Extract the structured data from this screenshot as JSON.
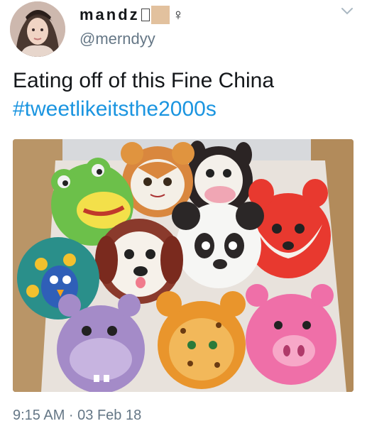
{
  "tweet": {
    "display_name_letters": "mandz",
    "display_name_symbol": "♀",
    "handle": "@merndyy",
    "text_line1": "Eating off of this Fine China",
    "hashtag": "#tweetlikeitsthe2000s",
    "timestamp": "9:15 AM · 03 Feb 18"
  },
  "icons": {
    "menu": "chevron-down-icon",
    "avatar": "profile-avatar"
  },
  "colors": {
    "text": "#14171a",
    "secondary": "#657786",
    "hashtag": "#1b95e0",
    "background": "#ffffff"
  }
}
